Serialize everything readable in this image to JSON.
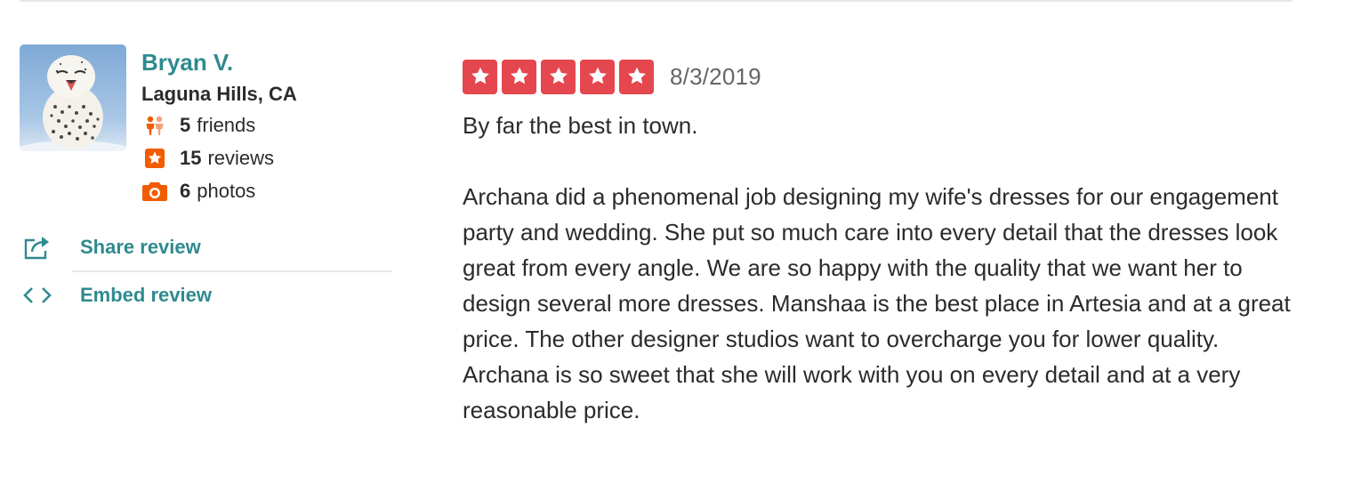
{
  "user": {
    "name": "Bryan V.",
    "location": "Laguna Hills, CA",
    "friends_count": "5",
    "friends_label": "friends",
    "reviews_count": "15",
    "reviews_label": "reviews",
    "photos_count": "6",
    "photos_label": "photos",
    "avatar_icon": "snowy-owl-photo"
  },
  "actions": {
    "share_label": "Share review",
    "embed_label": "Embed review",
    "share_icon": "share-icon",
    "embed_icon": "code-icon"
  },
  "review": {
    "rating": 5,
    "max_rating": 5,
    "date": "8/3/2019",
    "headline": "By far the best in town.",
    "body": "Archana did a phenomenal job designing my wife's dresses for our engagement party and wedding. She put so much care into every detail that the dresses look great from every angle. We are so happy with the quality that we want her to design several more dresses. Manshaa is the best place in Artesia and at a great price. The other designer studios want to overcharge you for lower quality. Archana is so sweet that she will work with you on every detail and at a very reasonable price."
  },
  "colors": {
    "accent_teal": "#2f8a8f",
    "star_red": "#e5474f",
    "stat_orange": "#f15c00",
    "text": "#2b2b2b",
    "muted": "#666666"
  }
}
